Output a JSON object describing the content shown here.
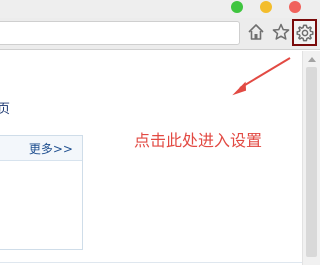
{
  "window": {
    "controls": [
      "green",
      "yellow",
      "red"
    ],
    "colors": {
      "green": "#3fc53f",
      "yellow": "#f3bd2c",
      "red": "#f0625c"
    }
  },
  "toolbar": {
    "icons": [
      "home-icon",
      "star-icon",
      "gear-icon"
    ],
    "settings_highlight_color": "#7a0a0a"
  },
  "page": {
    "partial_text": "页",
    "panel": {
      "more_link": "更多>>"
    }
  },
  "annotation": {
    "text": "点击此处进入设置",
    "color": "#e24a43"
  }
}
